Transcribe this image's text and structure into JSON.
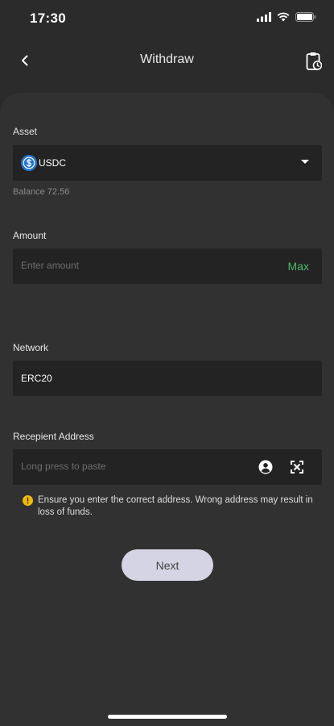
{
  "status_bar": {
    "time": "17:30"
  },
  "header": {
    "title": "Withdraw"
  },
  "asset": {
    "label": "Asset",
    "selected": "USDC",
    "balance": "Balance 72.56"
  },
  "amount": {
    "label": "Amount",
    "placeholder": "Enter amount",
    "max_label": "Max"
  },
  "network": {
    "label": "Network",
    "value": "ERC20"
  },
  "address": {
    "label": "Recepient Address",
    "placeholder": "Long press to paste"
  },
  "warning": {
    "text": "Ensure you enter the correct address. Wrong address may result in loss of funds."
  },
  "next_button": {
    "label": "Next"
  },
  "icons": {
    "back": "chevron-left-icon",
    "history": "clipboard-clock-icon",
    "asset": "usdc-icon",
    "dropdown": "triangle-down-icon",
    "contact": "contact-icon",
    "scan": "scan-icon",
    "warning": "warning-icon"
  },
  "colors": {
    "accent_green": "#4ab869",
    "usdc_blue": "#2775ca",
    "warning_yellow": "#f0b90b",
    "button_bg": "#d4d4e4"
  }
}
